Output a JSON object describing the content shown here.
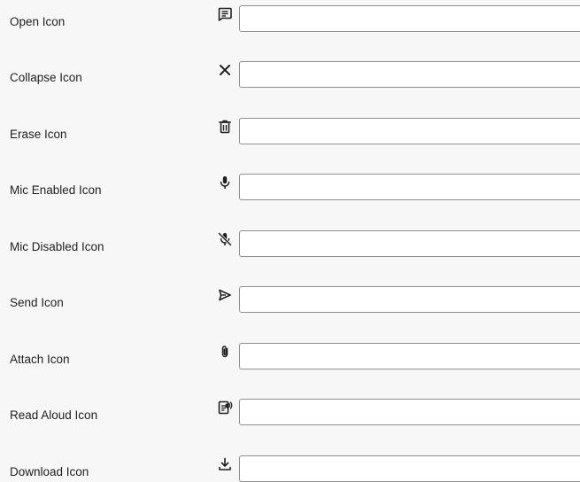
{
  "icon_settings": {
    "rows": [
      {
        "label": "Open Icon",
        "icon": "chat-message-icon",
        "value": ""
      },
      {
        "label": "Collapse Icon",
        "icon": "close-icon",
        "value": ""
      },
      {
        "label": "Erase Icon",
        "icon": "trash-icon",
        "value": ""
      },
      {
        "label": "Mic Enabled Icon",
        "icon": "mic-icon",
        "value": ""
      },
      {
        "label": "Mic Disabled Icon",
        "icon": "mic-off-icon",
        "value": ""
      },
      {
        "label": "Send Icon",
        "icon": "send-icon",
        "value": ""
      },
      {
        "label": "Attach Icon",
        "icon": "paperclip-icon",
        "value": ""
      },
      {
        "label": "Read Aloud Icon",
        "icon": "read-aloud-icon",
        "value": ""
      },
      {
        "label": "Download Icon",
        "icon": "download-icon",
        "value": ""
      }
    ]
  }
}
